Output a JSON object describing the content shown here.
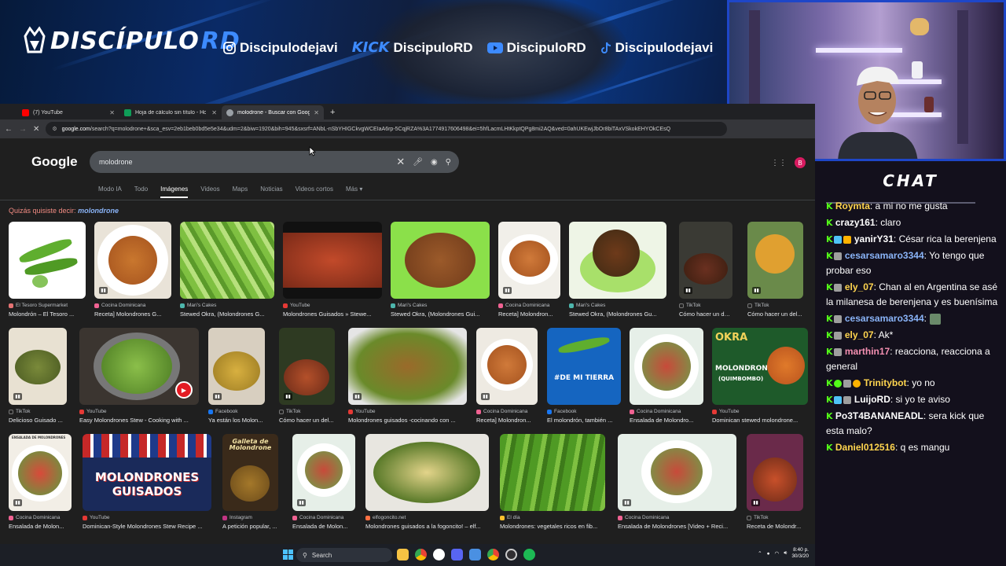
{
  "banner": {
    "logo_part1": "DISCÍPULO",
    "logo_part2": "RD",
    "socials": [
      {
        "icon": "instagram-icon",
        "label": "Discipulodejavi"
      },
      {
        "icon": "kick-logo",
        "prefix": "KICK",
        "label": "DiscipuloRD"
      },
      {
        "icon": "youtube-icon",
        "label": "DiscipuloRD"
      },
      {
        "icon": "tiktok-icon",
        "label": "Discipulodejavi"
      }
    ]
  },
  "browser": {
    "tabs": [
      {
        "label": "(7) YouTube",
        "color": "#ff0000"
      },
      {
        "label": "Hoja de cálculo sin título - Hoja",
        "color": "#0f9d58"
      },
      {
        "label": "molodrone - Buscar con Googl",
        "color": "#9aa0a6"
      }
    ],
    "new_tab": "+",
    "url_domain": "google.com",
    "url_rest": "/search?q=molodrone+&sca_esv=2eb1beb0bd5e5e34&udm=2&biw=1920&bih=945&sxsrf=ANbL-nSbYHIGCkvgWCEIaA6rp-5CqjRZA%3A1774917606498&ei=5hfLacmLHtKkptQPg8mi2AQ&ved=0ahUKEwjJbOr8biTAxVSkokEHYOkCEsQ"
  },
  "google": {
    "logo": "Google",
    "query": "molodrone",
    "tabs": [
      "Modo IA",
      "Todo",
      "Imágenes",
      "Videos",
      "Maps",
      "Noticias",
      "Videos cortos",
      "Más"
    ],
    "selected_tab": "Imágenes",
    "did_you_mean_prefix": "Quizás quisiste decir:",
    "did_you_mean_term": "molondrone",
    "avatar": "B"
  },
  "results": {
    "row1": [
      {
        "source": "El Tesoro Supermarket",
        "title": "Molondrón – El Tesoro ..."
      },
      {
        "source": "Cocina Dominicana",
        "title": "Receta] Molondrones G..."
      },
      {
        "source": "Mari's Cakes",
        "title": "Stewed Okra, (Molondrones G..."
      },
      {
        "source": "YouTube",
        "title": "Molondrones Guisados » Stewe..."
      },
      {
        "source": "Mari's Cakes",
        "title": "Stewed Okra, (Molondrones Gui..."
      },
      {
        "source": "Cocina Dominicana",
        "title": "Receta] Molondron..."
      },
      {
        "source": "Mari's Cakes",
        "title": "Stewed Okra, (Molondrones Gu..."
      },
      {
        "source": "TikTok",
        "title": "Cómo hacer un del..."
      },
      {
        "source": "TikTok",
        "title": "Cómo hacer un del..."
      }
    ],
    "row2": [
      {
        "source": "TikTok",
        "title": "Delicioso Guisado ..."
      },
      {
        "source": "YouTube",
        "title": "Easy Molondrones Stew - Cooking with ..."
      },
      {
        "source": "Facebook",
        "title": "Ya están los Molon..."
      },
      {
        "source": "TikTok",
        "title": "Cómo hacer un del..."
      },
      {
        "source": "YouTube",
        "title": "Molondrones guisados -cocinando con ..."
      },
      {
        "source": "Cocina Dominicana",
        "title": "Receta] Molondron..."
      },
      {
        "source": "Facebook",
        "title": "El molondrón, también ..."
      },
      {
        "source": "Cocina Dominicana",
        "title": "Ensalada de Molondro..."
      },
      {
        "source": "YouTube",
        "title": "Dominican stewed molondrone..."
      }
    ],
    "row3": [
      {
        "source": "Cocina Dominicana",
        "title": "Ensalada de Molon..."
      },
      {
        "source": "YouTube",
        "title": "Dominican-Style Molondrones Stew Recipe ..."
      },
      {
        "source": "Instagram",
        "title": "A petición popular, ..."
      },
      {
        "source": "Cocina Dominicana",
        "title": "Ensalada de Molon..."
      },
      {
        "source": "elfogoncito.net",
        "title": "Molondrones guisados a la fogoncito! – elf..."
      },
      {
        "source": "El día",
        "title": "Molondrones: vegetales ricos en fib..."
      },
      {
        "source": "Cocina Dominicana",
        "title": "Ensalada de Molondrones [Video + Reci..."
      },
      {
        "source": "TikTok",
        "title": "Receta de Molondr..."
      }
    ],
    "overlays": {
      "de_mi_tierra": "#DE MI TIERRA",
      "okra": "OKRA",
      "okra_sub": "MOLONDRONES",
      "okra_sub2": "(QUIMBOMBO)",
      "guisados_1": "MOLONDRONES",
      "guisados_2": "GUISADOS",
      "galleta": "Galleta de Molondrone",
      "ensalada_label": "ENSALADA DE MOLONDRONES"
    }
  },
  "taskbar": {
    "search_label": "Search",
    "time": "8:40 p.",
    "date": "30/3/20"
  },
  "chat": {
    "title": "CHAT",
    "messages": [
      {
        "user": "Roymta",
        "color": "#ffd54f",
        "text": ": a mi no me gusta"
      },
      {
        "user": "crazy161",
        "color": "#ffffff",
        "text": ": claro"
      },
      {
        "user": "yanirY31",
        "color": "#ffffff",
        "text": ": César rica la berenjena"
      },
      {
        "user": "cesarsamaro3344",
        "color": "#8ab4f8",
        "text": ": Yo tengo que probar eso"
      },
      {
        "user": "ely_07",
        "color": "#ffd54f",
        "text": ": Chan al en Argentina se asé la milanesa de berenjena y es buenísima"
      },
      {
        "user": "cesarsamaro3344",
        "color": "#8ab4f8",
        "text": ": "
      },
      {
        "user": "ely_07",
        "color": "#ffd54f",
        "text": ": Ak*"
      },
      {
        "user": "marthin17",
        "color": "#f48fb1",
        "text": ": reacciona, reacciona a general"
      },
      {
        "user": "Trinitybot",
        "color": "#ffd54f",
        "text": ": yo no"
      },
      {
        "user": "LuijoRD",
        "color": "#ffffff",
        "text": ": si yo te aviso"
      },
      {
        "user": "Po3T4BANANEADL",
        "color": "#ffffff",
        "text": ": sera kick que esta malo?"
      },
      {
        "user": "Daniel012516",
        "color": "#ffd54f",
        "text": ": q es mangu"
      }
    ]
  }
}
